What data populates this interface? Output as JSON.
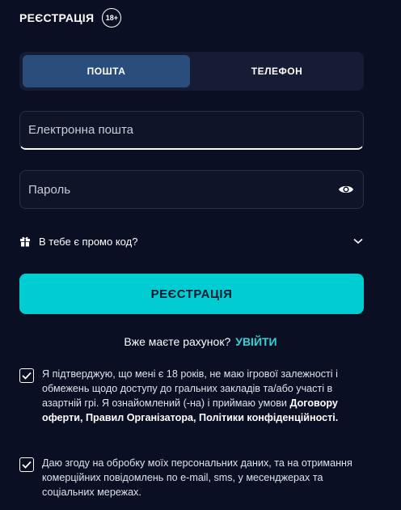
{
  "header": {
    "title": "РЕЄСТРАЦІЯ",
    "age_badge": "18+"
  },
  "tabs": [
    {
      "label": "ПОШТА",
      "active": true
    },
    {
      "label": "ТЕЛЕФОН",
      "active": false
    }
  ],
  "form": {
    "email_placeholder": "Електронна пошта",
    "email_value": "",
    "password_placeholder": "Пароль",
    "password_value": "",
    "password_toggle_icon": "eye-icon"
  },
  "promo": {
    "icon": "gift-icon",
    "label": "В тебе є промо код?",
    "chevron_icon": "chevron-down-icon"
  },
  "register_button": {
    "label": "РЕЄСТРАЦІЯ"
  },
  "login": {
    "prompt": "Вже маєте рахунок?",
    "link": "УВІЙТИ"
  },
  "consents": [
    {
      "checked": true,
      "text_intro": "Я підтверджую, що мені є 18 років, не маю ігрової залежності і обмежень щодо доступу до гральних закладів та/або участі в азартній грі. Я ознайомлений (-на) і приймаю умови ",
      "text_links": "Договору оферти, Правил Організатора, Політики конфіденційності."
    },
    {
      "checked": true,
      "text": "Даю згоду на обробку моїх персональних даних, та на отримання комерційних повідомлень по e-mail, sms, у месенджерах та соціальних мережах."
    }
  ],
  "colors": {
    "background": "#0b0f24",
    "tab_bar": "#161c34",
    "tab_active": "#2a4d7c",
    "field_bg": "#0f1429",
    "accent": "#00cdd2",
    "link": "#2ed3d6"
  }
}
